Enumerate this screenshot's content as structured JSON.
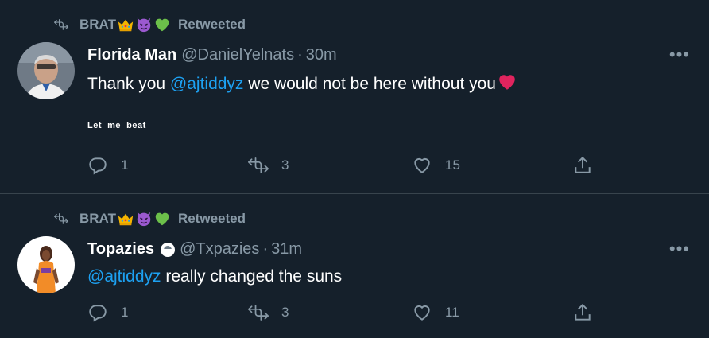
{
  "tweets": [
    {
      "retweeter": "BRAT",
      "retweeted_label": "Retweeted",
      "display_name": "Florida Man",
      "handle": "@DanielYelnats",
      "separator": "·",
      "time": "30m",
      "text_before": "Thank you ",
      "mention": "@ajtiddyz",
      "text_after": " we would not be here without you",
      "caption": "Let  me  beat",
      "replies": "1",
      "retweets": "3",
      "likes": "15"
    },
    {
      "retweeter": "BRAT",
      "retweeted_label": "Retweeted",
      "display_name": "Topazies",
      "handle": "@Txpazies",
      "separator": "·",
      "time": "31m",
      "mention": "@ajtiddyz",
      "text_after": " really changed the suns",
      "replies": "1",
      "retweets": "3",
      "likes": "11"
    }
  ],
  "colors": {
    "background": "#15202b",
    "muted": "#8899a6",
    "accent": "#1da1f2",
    "divider": "#38444d"
  },
  "icons": [
    "retweet-icon",
    "crown-emoji",
    "devil-emoji",
    "green-heart-emoji",
    "red-heart-emoji",
    "reply-icon",
    "like-icon",
    "share-icon",
    "more-icon",
    "verified-circle-icon"
  ]
}
